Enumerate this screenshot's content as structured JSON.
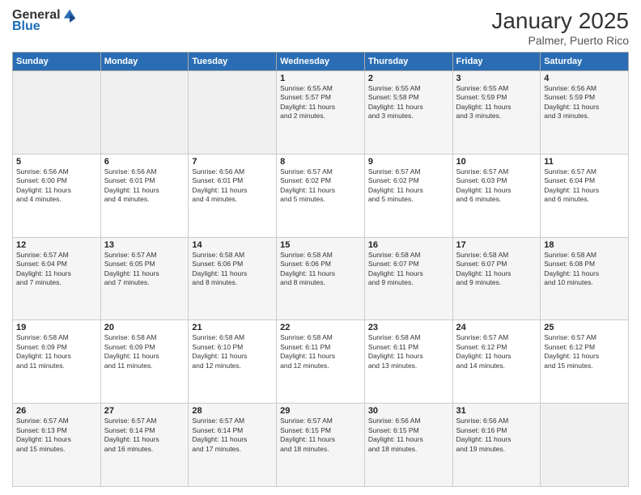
{
  "logo": {
    "general": "General",
    "blue": "Blue"
  },
  "title": {
    "month": "January 2025",
    "location": "Palmer, Puerto Rico"
  },
  "weekdays": [
    "Sunday",
    "Monday",
    "Tuesday",
    "Wednesday",
    "Thursday",
    "Friday",
    "Saturday"
  ],
  "weeks": [
    [
      {
        "day": "",
        "info": ""
      },
      {
        "day": "",
        "info": ""
      },
      {
        "day": "",
        "info": ""
      },
      {
        "day": "1",
        "info": "Sunrise: 6:55 AM\nSunset: 5:57 PM\nDaylight: 11 hours\nand 2 minutes."
      },
      {
        "day": "2",
        "info": "Sunrise: 6:55 AM\nSunset: 5:58 PM\nDaylight: 11 hours\nand 3 minutes."
      },
      {
        "day": "3",
        "info": "Sunrise: 6:55 AM\nSunset: 5:59 PM\nDaylight: 11 hours\nand 3 minutes."
      },
      {
        "day": "4",
        "info": "Sunrise: 6:56 AM\nSunset: 5:59 PM\nDaylight: 11 hours\nand 3 minutes."
      }
    ],
    [
      {
        "day": "5",
        "info": "Sunrise: 6:56 AM\nSunset: 6:00 PM\nDaylight: 11 hours\nand 4 minutes."
      },
      {
        "day": "6",
        "info": "Sunrise: 6:56 AM\nSunset: 6:01 PM\nDaylight: 11 hours\nand 4 minutes."
      },
      {
        "day": "7",
        "info": "Sunrise: 6:56 AM\nSunset: 6:01 PM\nDaylight: 11 hours\nand 4 minutes."
      },
      {
        "day": "8",
        "info": "Sunrise: 6:57 AM\nSunset: 6:02 PM\nDaylight: 11 hours\nand 5 minutes."
      },
      {
        "day": "9",
        "info": "Sunrise: 6:57 AM\nSunset: 6:02 PM\nDaylight: 11 hours\nand 5 minutes."
      },
      {
        "day": "10",
        "info": "Sunrise: 6:57 AM\nSunset: 6:03 PM\nDaylight: 11 hours\nand 6 minutes."
      },
      {
        "day": "11",
        "info": "Sunrise: 6:57 AM\nSunset: 6:04 PM\nDaylight: 11 hours\nand 6 minutes."
      }
    ],
    [
      {
        "day": "12",
        "info": "Sunrise: 6:57 AM\nSunset: 6:04 PM\nDaylight: 11 hours\nand 7 minutes."
      },
      {
        "day": "13",
        "info": "Sunrise: 6:57 AM\nSunset: 6:05 PM\nDaylight: 11 hours\nand 7 minutes."
      },
      {
        "day": "14",
        "info": "Sunrise: 6:58 AM\nSunset: 6:06 PM\nDaylight: 11 hours\nand 8 minutes."
      },
      {
        "day": "15",
        "info": "Sunrise: 6:58 AM\nSunset: 6:06 PM\nDaylight: 11 hours\nand 8 minutes."
      },
      {
        "day": "16",
        "info": "Sunrise: 6:58 AM\nSunset: 6:07 PM\nDaylight: 11 hours\nand 9 minutes."
      },
      {
        "day": "17",
        "info": "Sunrise: 6:58 AM\nSunset: 6:07 PM\nDaylight: 11 hours\nand 9 minutes."
      },
      {
        "day": "18",
        "info": "Sunrise: 6:58 AM\nSunset: 6:08 PM\nDaylight: 11 hours\nand 10 minutes."
      }
    ],
    [
      {
        "day": "19",
        "info": "Sunrise: 6:58 AM\nSunset: 6:09 PM\nDaylight: 11 hours\nand 11 minutes."
      },
      {
        "day": "20",
        "info": "Sunrise: 6:58 AM\nSunset: 6:09 PM\nDaylight: 11 hours\nand 11 minutes."
      },
      {
        "day": "21",
        "info": "Sunrise: 6:58 AM\nSunset: 6:10 PM\nDaylight: 11 hours\nand 12 minutes."
      },
      {
        "day": "22",
        "info": "Sunrise: 6:58 AM\nSunset: 6:11 PM\nDaylight: 11 hours\nand 12 minutes."
      },
      {
        "day": "23",
        "info": "Sunrise: 6:58 AM\nSunset: 6:11 PM\nDaylight: 11 hours\nand 13 minutes."
      },
      {
        "day": "24",
        "info": "Sunrise: 6:57 AM\nSunset: 6:12 PM\nDaylight: 11 hours\nand 14 minutes."
      },
      {
        "day": "25",
        "info": "Sunrise: 6:57 AM\nSunset: 6:12 PM\nDaylight: 11 hours\nand 15 minutes."
      }
    ],
    [
      {
        "day": "26",
        "info": "Sunrise: 6:57 AM\nSunset: 6:13 PM\nDaylight: 11 hours\nand 15 minutes."
      },
      {
        "day": "27",
        "info": "Sunrise: 6:57 AM\nSunset: 6:14 PM\nDaylight: 11 hours\nand 16 minutes."
      },
      {
        "day": "28",
        "info": "Sunrise: 6:57 AM\nSunset: 6:14 PM\nDaylight: 11 hours\nand 17 minutes."
      },
      {
        "day": "29",
        "info": "Sunrise: 6:57 AM\nSunset: 6:15 PM\nDaylight: 11 hours\nand 18 minutes."
      },
      {
        "day": "30",
        "info": "Sunrise: 6:56 AM\nSunset: 6:15 PM\nDaylight: 11 hours\nand 18 minutes."
      },
      {
        "day": "31",
        "info": "Sunrise: 6:56 AM\nSunset: 6:16 PM\nDaylight: 11 hours\nand 19 minutes."
      },
      {
        "day": "",
        "info": ""
      }
    ]
  ]
}
